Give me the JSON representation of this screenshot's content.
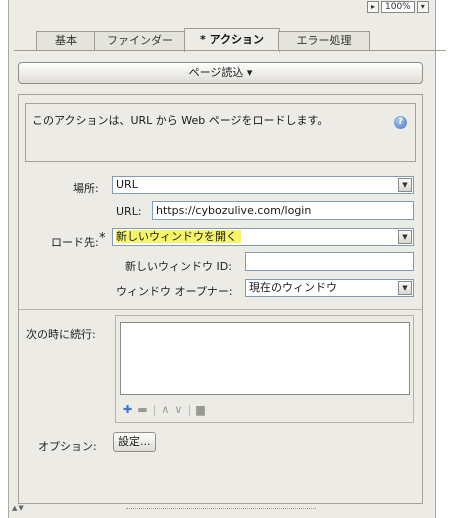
{
  "zoom": {
    "value": "100%"
  },
  "tabs": [
    {
      "label": "基本"
    },
    {
      "label": "ファインダー"
    },
    {
      "label": "アクション",
      "marker": "*"
    },
    {
      "label": "エラー処理"
    }
  ],
  "page_read_button": {
    "label": "ページ読込 ▾"
  },
  "description": "このアクションは、URL から Web ページをロードします。",
  "form": {
    "location_label": "場所:",
    "location_value": "URL",
    "url_label": "URL:",
    "url_value": "https://cybozulive.com/login",
    "load_to_label": "ロード先:",
    "load_to_marker": "*",
    "load_to_value": "新しいウィンドウを開く",
    "new_window_id_label": "新しいウィンドウ ID:",
    "new_window_id_value": "",
    "opener_label": "ウィンドウ オープナー:",
    "opener_value": "現在のウィンドウ",
    "continue_label": "次の時に続行:",
    "options_label": "オプション:",
    "settings_button": "設定..."
  },
  "icons": {
    "help": "help-icon",
    "add": "plus-icon",
    "remove": "minus-icon",
    "up": "arrow-up-icon",
    "down": "arrow-down-icon",
    "clear": "clear-icon",
    "dropdown": "chevron-down-icon"
  }
}
